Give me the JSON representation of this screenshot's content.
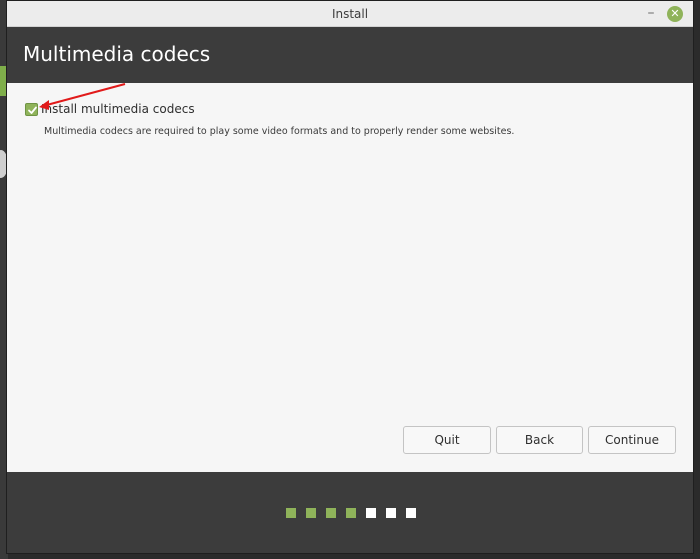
{
  "window": {
    "title": "Install",
    "minimize_label": "–",
    "close_label": "✕"
  },
  "header": {
    "title": "Multimedia codecs"
  },
  "content": {
    "checkbox": {
      "label": "Install multimedia codecs",
      "checked": true
    },
    "description": "Multimedia codecs are required to play some video formats and to properly render some websites."
  },
  "buttons": {
    "quit": "Quit",
    "back": "Back",
    "continue": "Continue"
  },
  "progress": {
    "completed_steps": 4,
    "total_steps": 7
  },
  "colors": {
    "accent": "#8fb35a",
    "header_bg": "#3c3c3c",
    "annotation": "#e11a1a"
  }
}
